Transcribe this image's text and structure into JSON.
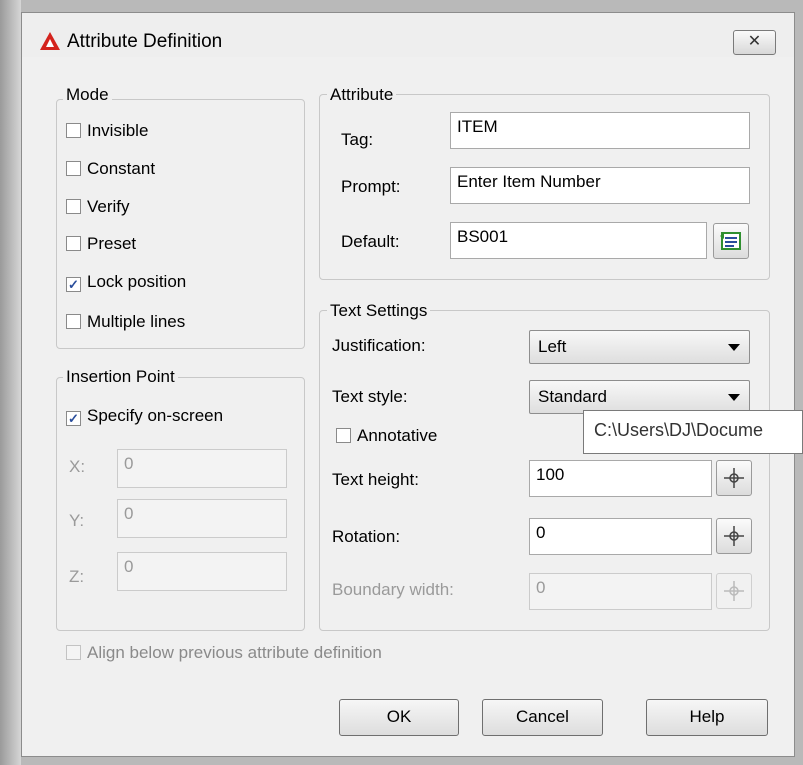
{
  "window": {
    "title": "Attribute Definition",
    "close_glyph": "✕"
  },
  "mode": {
    "label": "Mode",
    "invisible": {
      "label": "Invisible",
      "checked": false
    },
    "constant": {
      "label": "Constant",
      "checked": false
    },
    "verify": {
      "label": "Verify",
      "checked": false
    },
    "preset": {
      "label": "Preset",
      "checked": false
    },
    "lock_position": {
      "label": "Lock position",
      "checked": true
    },
    "multiple_lines": {
      "label": "Multiple lines",
      "checked": false
    }
  },
  "attribute": {
    "label": "Attribute",
    "tag_label": "Tag:",
    "tag_value": "ITEM",
    "prompt_label": "Prompt:",
    "prompt_value": "Enter Item Number",
    "default_label": "Default:",
    "default_value": "BS001"
  },
  "insertion": {
    "label": "Insertion Point",
    "specify_onscreen": {
      "label": "Specify on-screen",
      "checked": true
    },
    "x_label": "X:",
    "x_value": "0",
    "y_label": "Y:",
    "y_value": "0",
    "z_label": "Z:",
    "z_value": "0"
  },
  "text_settings": {
    "label": "Text Settings",
    "justification_label": "Justification:",
    "justification_value": "Left",
    "text_style_label": "Text style:",
    "text_style_value": "Standard",
    "annotative": {
      "label": "Annotative",
      "checked": false
    },
    "text_height_label": "Text height:",
    "text_height_value": "100",
    "rotation_label": "Rotation:",
    "rotation_value": "0",
    "boundary_width_label": "Boundary width:",
    "boundary_width_value": "0"
  },
  "tooltip": "C:\\Users\\DJ\\Docume",
  "align_below": {
    "label": "Align below previous attribute definition",
    "checked": false
  },
  "buttons": {
    "ok": "OK",
    "cancel": "Cancel",
    "help": "Help"
  },
  "colors": {
    "accent": "#2a4e9c",
    "app_icon_red": "#d4231d",
    "field_icon_green": "#2f8f2f"
  },
  "icons": {
    "app": "autocad-a-icon",
    "insert_field": "insert-field-icon",
    "pick_point": "pick-point-icon"
  }
}
